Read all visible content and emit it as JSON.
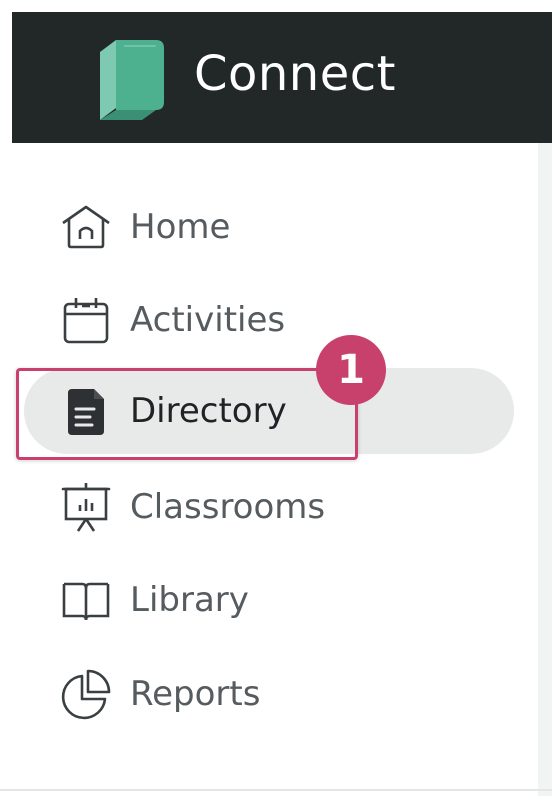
{
  "app": {
    "title": "Connect",
    "brand_color": "#4db08f",
    "header_bg": "#222828"
  },
  "sidebar": {
    "items": [
      {
        "label": "Home",
        "icon": "home-icon",
        "active": false
      },
      {
        "label": "Activities",
        "icon": "calendar-icon",
        "active": false
      },
      {
        "label": "Directory",
        "icon": "document-icon",
        "active": true
      },
      {
        "label": "Classrooms",
        "icon": "presentation-board-icon",
        "active": false
      },
      {
        "label": "Library",
        "icon": "open-book-icon",
        "active": false
      },
      {
        "label": "Reports",
        "icon": "pie-chart-icon",
        "active": false
      }
    ]
  },
  "callout": {
    "step_number": "1",
    "color": "#c8416d"
  }
}
